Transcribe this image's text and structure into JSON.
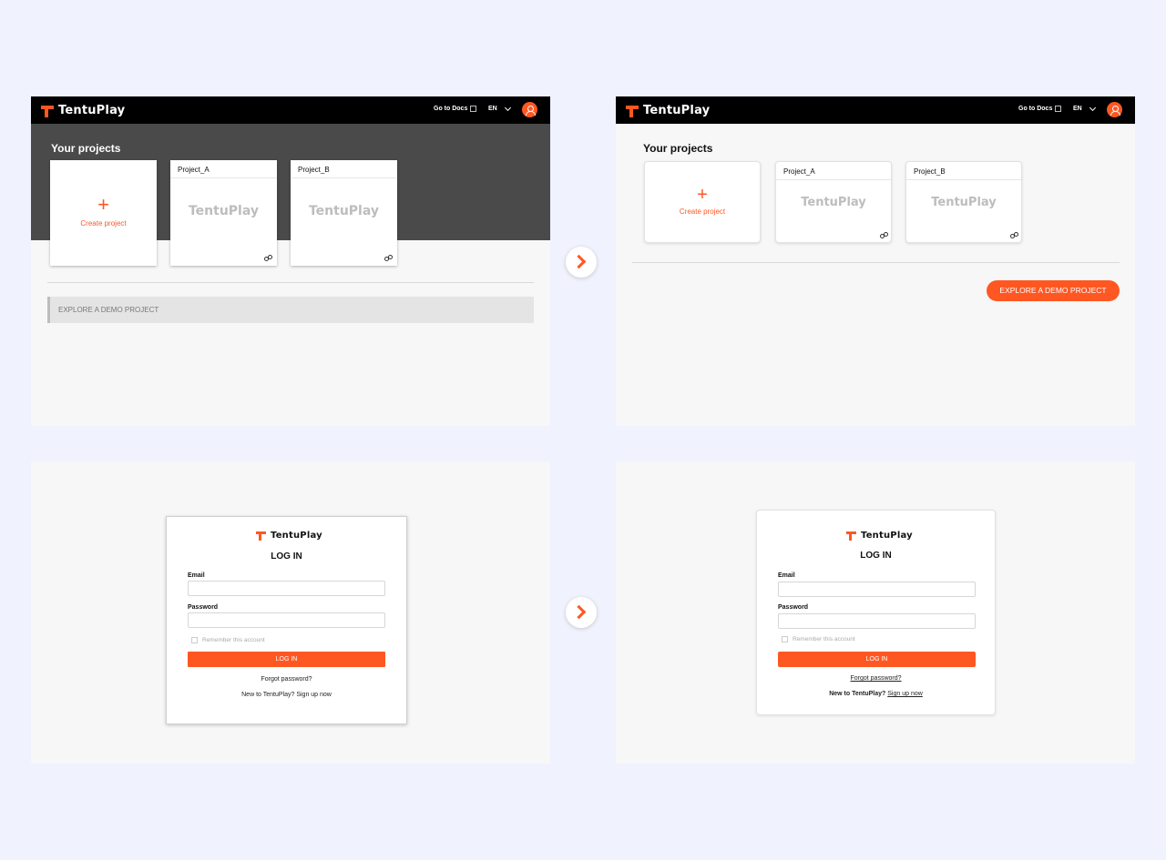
{
  "brand": {
    "name": "TentuPlay",
    "accent": "#ff5722"
  },
  "header": {
    "docs_label": "Go to Docs",
    "lang": "EN"
  },
  "projects": {
    "heading": "Your projects",
    "create_label": "Create project",
    "items": [
      {
        "name": "Project_A"
      },
      {
        "name": "Project_B"
      }
    ]
  },
  "demo": {
    "label": "EXPLORE A DEMO PROJECT"
  },
  "login": {
    "title": "LOG IN",
    "email_label": "Email",
    "password_label": "Password",
    "remember_label": "Remember this account",
    "button_label": "LOG IN",
    "forgot_label": "Forgot password?",
    "signup_prompt": "New to TentuPlay?",
    "signup_link": "Sign up now"
  }
}
